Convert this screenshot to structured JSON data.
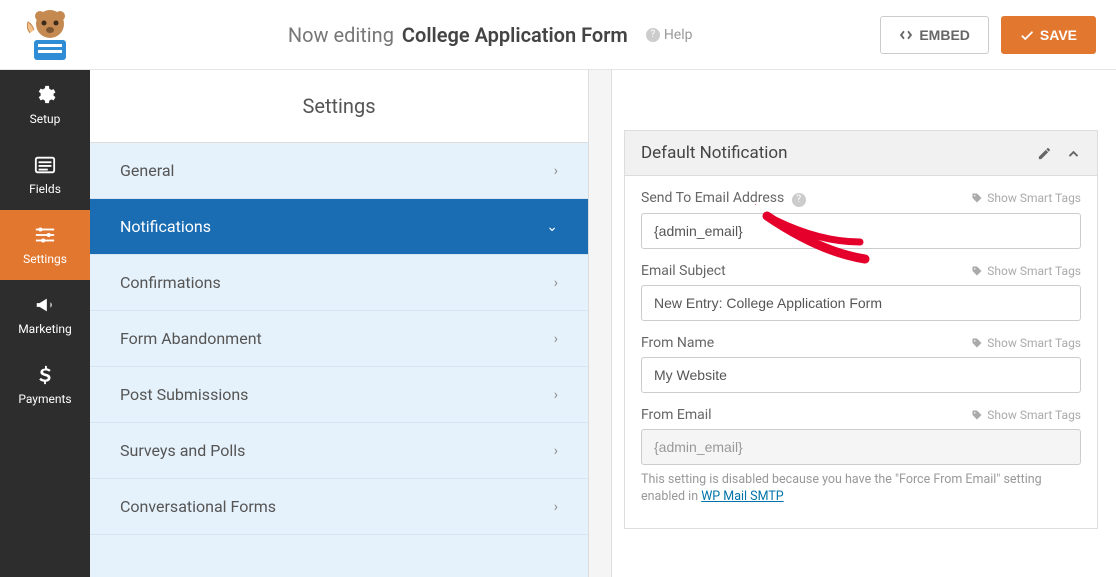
{
  "top": {
    "editing_prefix": "Now editing",
    "form_name": "College Application Form",
    "help": "Help",
    "embed": "EMBED",
    "save": "SAVE"
  },
  "nav": {
    "setup": "Setup",
    "fields": "Fields",
    "settings": "Settings",
    "marketing": "Marketing",
    "payments": "Payments"
  },
  "settings": {
    "title": "Settings",
    "items": [
      {
        "label": "General",
        "active": false
      },
      {
        "label": "Notifications",
        "active": true
      },
      {
        "label": "Confirmations",
        "active": false
      },
      {
        "label": "Form Abandonment",
        "active": false
      },
      {
        "label": "Post Submissions",
        "active": false
      },
      {
        "label": "Surveys and Polls",
        "active": false
      },
      {
        "label": "Conversational Forms",
        "active": false
      }
    ]
  },
  "notification": {
    "title": "Default Notification",
    "send_to_label": "Send To Email Address",
    "send_to_value": "{admin_email}",
    "subject_label": "Email Subject",
    "subject_value": "New Entry: College Application Form",
    "from_name_label": "From Name",
    "from_name_value": "My Website",
    "from_email_label": "From Email",
    "from_email_value": "{admin_email}",
    "smart_tags": "Show Smart Tags",
    "note_prefix": "This setting is disabled because you have the \"Force From Email\" setting enabled in ",
    "note_link": "WP Mail SMTP"
  }
}
